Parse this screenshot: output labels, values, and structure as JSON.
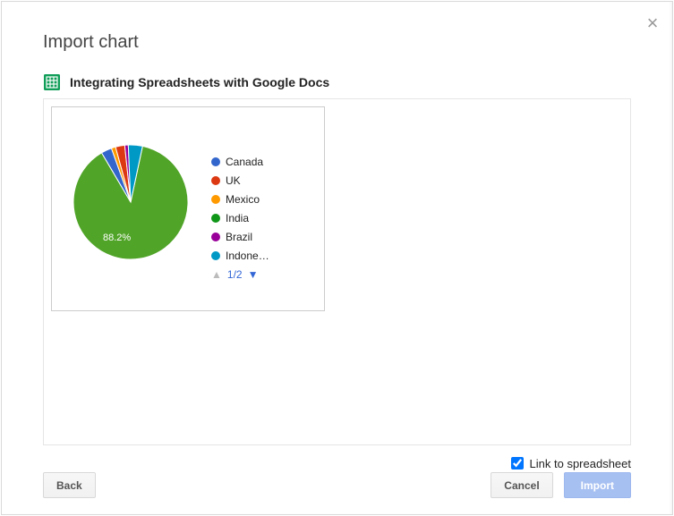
{
  "dialog": {
    "title": "Import chart",
    "source_doc": "Integrating Spreadsheets with Google Docs",
    "link_checkbox": {
      "label": "Link to spreadsheet",
      "checked": true
    },
    "buttons": {
      "back": "Back",
      "cancel": "Cancel",
      "import": "Import"
    }
  },
  "legend": {
    "items": [
      {
        "label": "Canada",
        "color": "#3366cc"
      },
      {
        "label": "UK",
        "color": "#dc3912"
      },
      {
        "label": "Mexico",
        "color": "#ff9900"
      },
      {
        "label": "India",
        "color": "#109618"
      },
      {
        "label": "Brazil",
        "color": "#990099"
      },
      {
        "label": "Indone…",
        "color": "#0099c6"
      }
    ],
    "pager": "1/2"
  },
  "chart_data": {
    "type": "pie",
    "title": "",
    "slices": [
      {
        "name": "India",
        "value": 88.2,
        "color": "#50a428"
      },
      {
        "name": "Canada",
        "value": 3.0,
        "color": "#3366cc"
      },
      {
        "name": "Mexico",
        "value": 1.2,
        "color": "#ff9900"
      },
      {
        "name": "UK",
        "value": 2.6,
        "color": "#dc3912"
      },
      {
        "name": "Brazil",
        "value": 1.0,
        "color": "#990099"
      },
      {
        "name": "Indonesia",
        "value": 4.0,
        "color": "#0099c6"
      }
    ],
    "data_label_shown": "88.2%"
  }
}
